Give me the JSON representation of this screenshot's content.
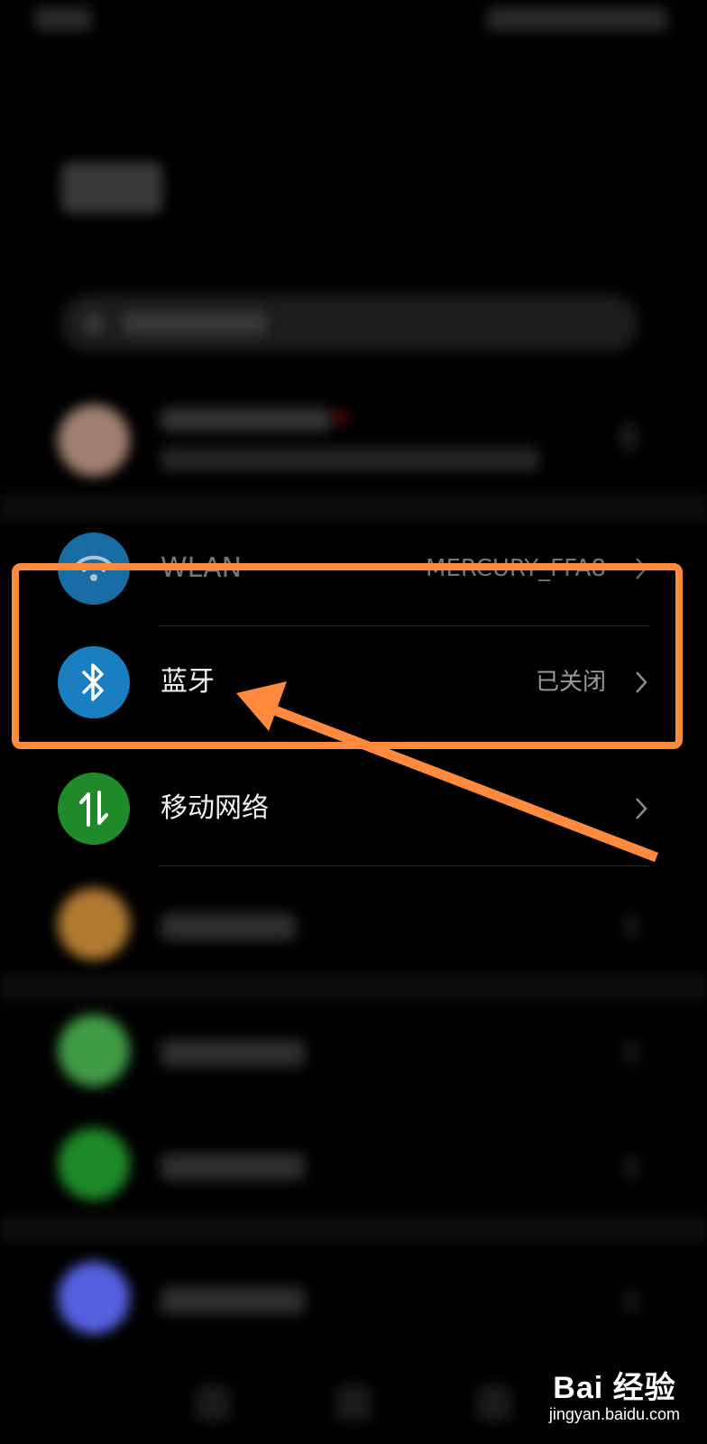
{
  "settings": {
    "wlan": {
      "label": "WLAN",
      "value": "MERCURY_FFA8"
    },
    "bluetooth": {
      "label": "蓝牙",
      "value": "已关闭"
    },
    "mobile_network": {
      "label": "移动网络"
    }
  },
  "colors": {
    "wlan_icon": "#1a7fc0",
    "bluetooth_icon": "#1a7fc0",
    "mobile_network_icon": "#1f8a2a",
    "highlight": "#ff8a3d"
  },
  "icons": {
    "wlan": "wifi-icon",
    "bluetooth": "bluetooth-icon",
    "mobile_network": "arrows-updown-icon",
    "chevron": "chevron-right-icon"
  },
  "watermark": {
    "brand": "Bai 经验",
    "url": "jingyan.baidu.com"
  }
}
